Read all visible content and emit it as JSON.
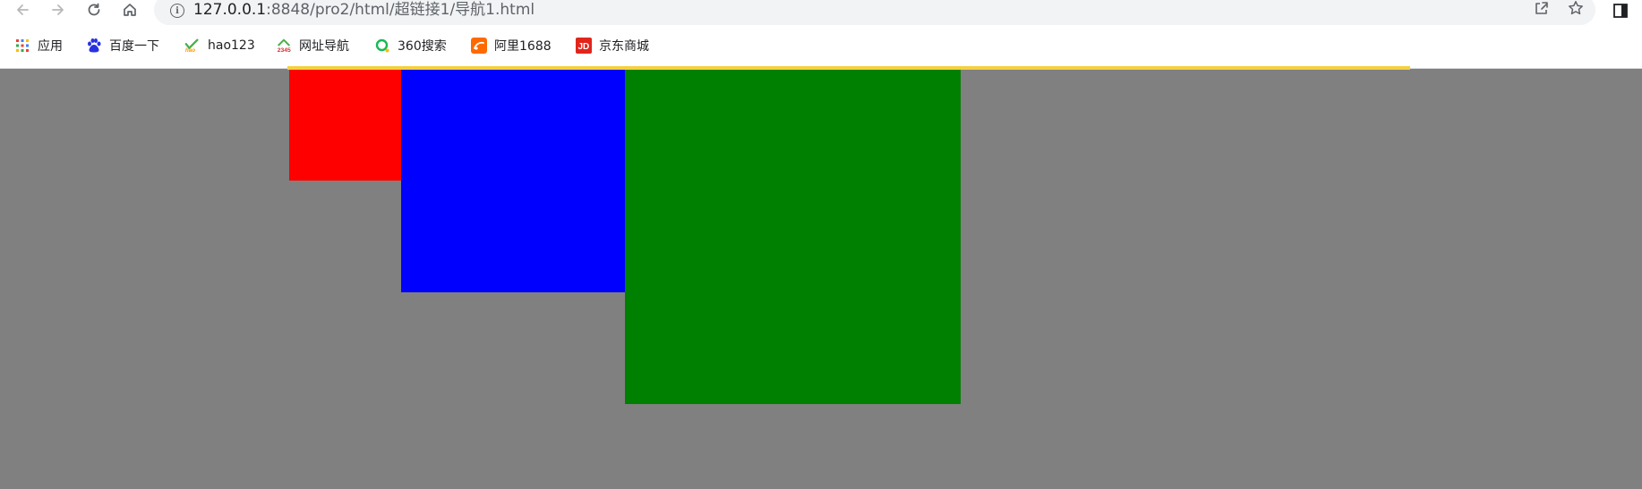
{
  "browser": {
    "url_host": "127.0.0.1",
    "url_path": ":8848/pro2/html/超链接1/导航1.html",
    "info_glyph": "i",
    "nav_icons": [
      "back-icon",
      "forward-icon",
      "reload-icon",
      "home-icon"
    ],
    "address_icons": [
      "share-icon",
      "bookmark-star-icon"
    ],
    "side_panel_icon": "side-panel-icon"
  },
  "bookmarks": [
    {
      "label": "应用",
      "icon": "apps-grid-icon",
      "color": "#4285f4"
    },
    {
      "label": "百度一下",
      "icon": "baidu-paw-icon",
      "color": "#2932e1"
    },
    {
      "label": "hao123",
      "icon": "hao123-icon",
      "color": "#4caf50"
    },
    {
      "label": "网址导航",
      "icon": "2345-icon",
      "color": "#d32f2f"
    },
    {
      "label": "360搜索",
      "icon": "360-search-icon",
      "color": "#19b955"
    },
    {
      "label": "阿里1688",
      "icon": "ali1688-icon",
      "color": "#ff6a00"
    },
    {
      "label": "京东商城",
      "icon": "jd-icon",
      "color": "#e1251b"
    }
  ],
  "page": {
    "background": "#808080",
    "strip_color": "#f4d03f",
    "boxes": [
      {
        "name": "red-box",
        "color": "#ff0000"
      },
      {
        "name": "blue-box",
        "color": "#0000ff"
      },
      {
        "name": "green-box",
        "color": "#008000"
      }
    ]
  }
}
